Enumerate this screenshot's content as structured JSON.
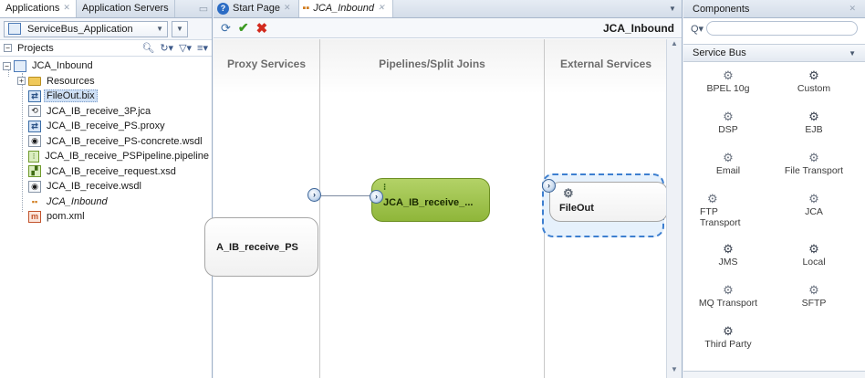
{
  "left_panel": {
    "tabs": [
      {
        "label": "Applications",
        "active": true
      },
      {
        "label": "Application Servers",
        "active": false
      }
    ],
    "app_selector": "ServiceBus_Application",
    "projects_label": "Projects",
    "tree": [
      {
        "label": "JCA_Inbound",
        "level": 0,
        "icon": "project-icon",
        "expander": "−"
      },
      {
        "label": "Resources",
        "level": 1,
        "icon": "folder-icon",
        "expander": "+"
      },
      {
        "label": "FileOut.bix",
        "level": 1,
        "icon": "business-service-icon",
        "selected": true
      },
      {
        "label": "JCA_IB_receive_3P.jca",
        "level": 1,
        "icon": "jca-icon"
      },
      {
        "label": "JCA_IB_receive_PS.proxy",
        "level": 1,
        "icon": "proxy-icon"
      },
      {
        "label": "JCA_IB_receive_PS-concrete.wsdl",
        "level": 1,
        "icon": "wsdl-icon"
      },
      {
        "label": "JCA_IB_receive_PSPipeline.pipeline",
        "level": 1,
        "icon": "pipeline-icon"
      },
      {
        "label": "JCA_IB_receive_request.xsd",
        "level": 1,
        "icon": "xsd-icon"
      },
      {
        "label": "JCA_IB_receive.wsdl",
        "level": 1,
        "icon": "wsdl-icon"
      },
      {
        "label": "JCA_Inbound",
        "level": 1,
        "icon": "composite-icon",
        "italic": true
      },
      {
        "label": "pom.xml",
        "level": 1,
        "icon": "xml-icon"
      }
    ]
  },
  "editor": {
    "tabs": [
      {
        "label": "Start Page",
        "active": false
      },
      {
        "label": "JCA_Inbound",
        "active": true
      }
    ],
    "title": "JCA_Inbound",
    "lanes": [
      "Proxy Services",
      "Pipelines/Split Joins",
      "External Services"
    ],
    "nodes": {
      "proxy": "A_IB_receive_PS",
      "pipeline": "JCA_IB_receive_...",
      "external": "FileOut"
    }
  },
  "components": {
    "title": "Components",
    "category": "Service Bus",
    "items": [
      {
        "label": "BPEL 10g",
        "icon": "gear-icon"
      },
      {
        "label": "Custom",
        "icon": "custom-gear-icon"
      },
      {
        "label": "DSP",
        "icon": "gear-icon"
      },
      {
        "label": "EJB",
        "icon": "ejb-gear-icon"
      },
      {
        "label": "Email",
        "icon": "gear-icon"
      },
      {
        "label": "File Transport",
        "icon": "gear-icon"
      },
      {
        "label": "FTP Transport",
        "icon": "gear-icon"
      },
      {
        "label": "JCA",
        "icon": "gear-icon"
      },
      {
        "label": "JMS",
        "icon": "jms-gear-icon"
      },
      {
        "label": "Local",
        "icon": "local-gear-icon"
      },
      {
        "label": "MQ Transport",
        "icon": "gear-icon"
      },
      {
        "label": "SFTP",
        "icon": "gear-icon"
      },
      {
        "label": "Third Party",
        "icon": "third-party-gear-icon"
      }
    ]
  },
  "colors": {
    "pipeline_fill": "#9fc44c",
    "selection_dash": "#3d7fd0",
    "tab_bar": "#d4dde9"
  }
}
